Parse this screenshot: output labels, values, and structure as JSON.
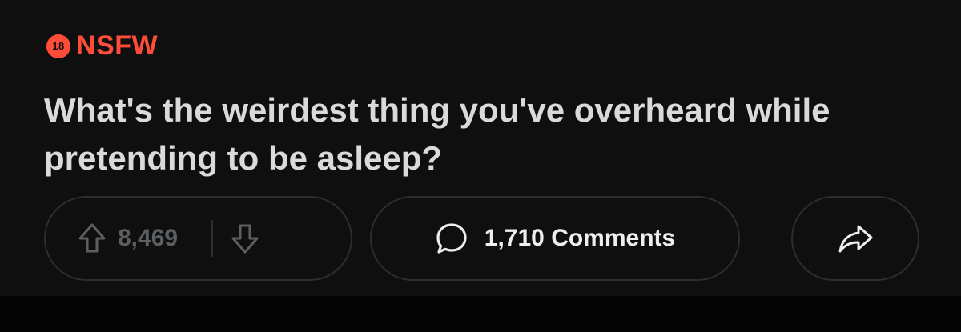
{
  "post": {
    "tag": {
      "badge": "18",
      "label": "NSFW",
      "color": "#ff4d3a"
    },
    "title": "What's the weirdest thing you've overheard while pretending to be asleep?"
  },
  "actions": {
    "vote_count": "8,469",
    "comments_label": "1,710 Comments",
    "icons": {
      "upvote": "arrow-up-icon",
      "downvote": "arrow-down-icon",
      "comment": "speech-bubble-icon",
      "share": "share-arrow-icon"
    }
  }
}
